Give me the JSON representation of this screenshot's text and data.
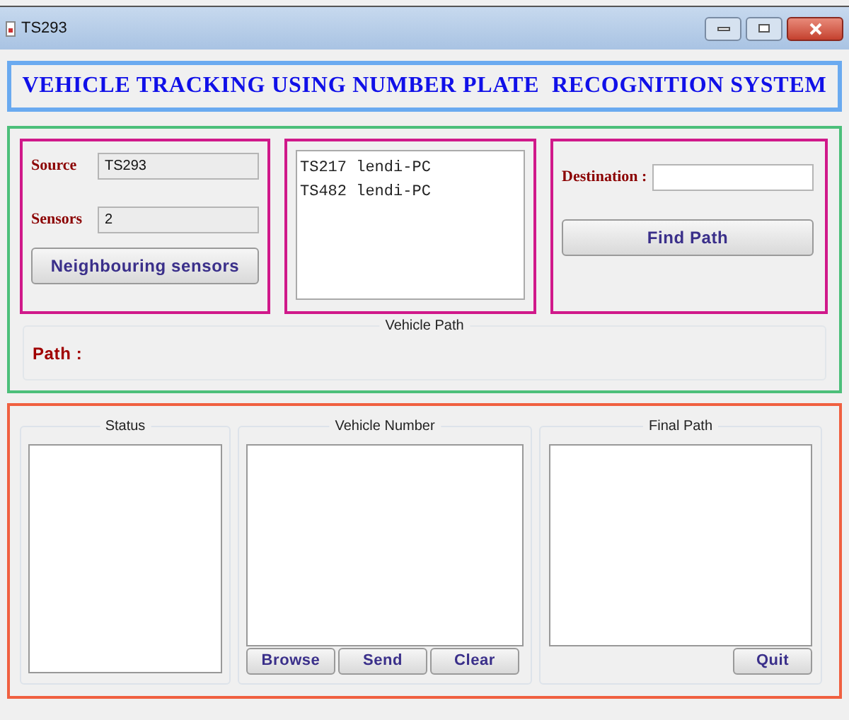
{
  "window": {
    "title": "TS293"
  },
  "banner": "VEHICLE TRACKING USING NUMBER PLATE  RECOGNITION SYSTEM",
  "source": {
    "label": "Source",
    "value": "TS293"
  },
  "sensors": {
    "label": "Sensors",
    "value": "2"
  },
  "neighbour_button": "Neighbouring sensors",
  "neighbour_list": [
    "TS217 lendi-PC",
    "TS482 lendi-PC"
  ],
  "destination": {
    "label": "Destination :"
  },
  "find_button": "Find Path",
  "vehicle_path": {
    "title": "Vehicle Path",
    "label": "Path :"
  },
  "status": {
    "title": "Status"
  },
  "vehicle_number": {
    "title": "Vehicle Number",
    "buttons": [
      "Browse",
      "Send",
      "Clear"
    ]
  },
  "final_path": {
    "title": "Final Path",
    "buttons": [
      "Quit"
    ]
  }
}
